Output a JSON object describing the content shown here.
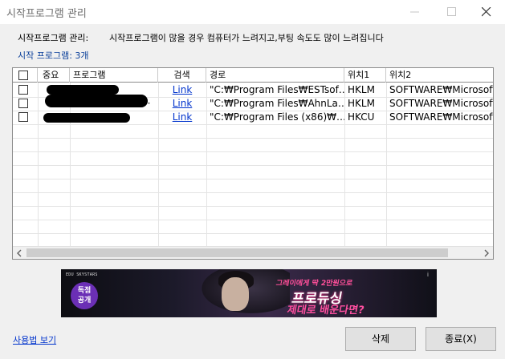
{
  "window": {
    "title": "시작프로그램 관리"
  },
  "info": {
    "desc_label": "시작프로그램 관리:",
    "desc_text": "시작프로그램이 많을 경우 컴퓨터가 느려지고,부팅 속도도 많이 느려집니다",
    "count_label": "시작 프로그램: 3개"
  },
  "table": {
    "headers": [
      "",
      "중요",
      "프로그램",
      "검색",
      "경로",
      "위치1",
      "위치2"
    ],
    "rows": [
      {
        "search": "Link",
        "path": "\"C:₩Program Files₩ESTsof…",
        "loc1": "HKLM",
        "loc2": "SOFTWARE₩Microsoft₩"
      },
      {
        "search": "Link",
        "path": "\"C:₩Program Files₩AhnLa…",
        "loc1": "HKLM",
        "loc2": "SOFTWARE₩Microsoft₩"
      },
      {
        "search": "Link",
        "path": "\"C:₩Program Files (x86)₩…",
        "loc1": "HKCU",
        "loc2": "SOFTWARE₩Microsoft₩"
      }
    ],
    "row2_program_tail": "···"
  },
  "banner": {
    "brand": "EDU  SKYSTARS",
    "badge": "독점\n공개",
    "line1": "그레이에게 딱 2만원으로",
    "line2": "프로듀싱",
    "line3": "제대로 배운다면?",
    "info_glyph": "i"
  },
  "footer": {
    "howto_link": "사용법 보기",
    "delete_button": "삭제",
    "exit_button": "종료(X)"
  },
  "colors": {
    "link": "#0033cc",
    "count_text": "#0a3f9a",
    "banner_accent": "#ff4f9a"
  },
  "icons": {
    "minimize": "minimize-icon",
    "maximize": "maximize-icon",
    "close": "close-icon",
    "scroll_left": "scroll-left-arrow-icon",
    "scroll_right": "scroll-right-arrow-icon"
  }
}
